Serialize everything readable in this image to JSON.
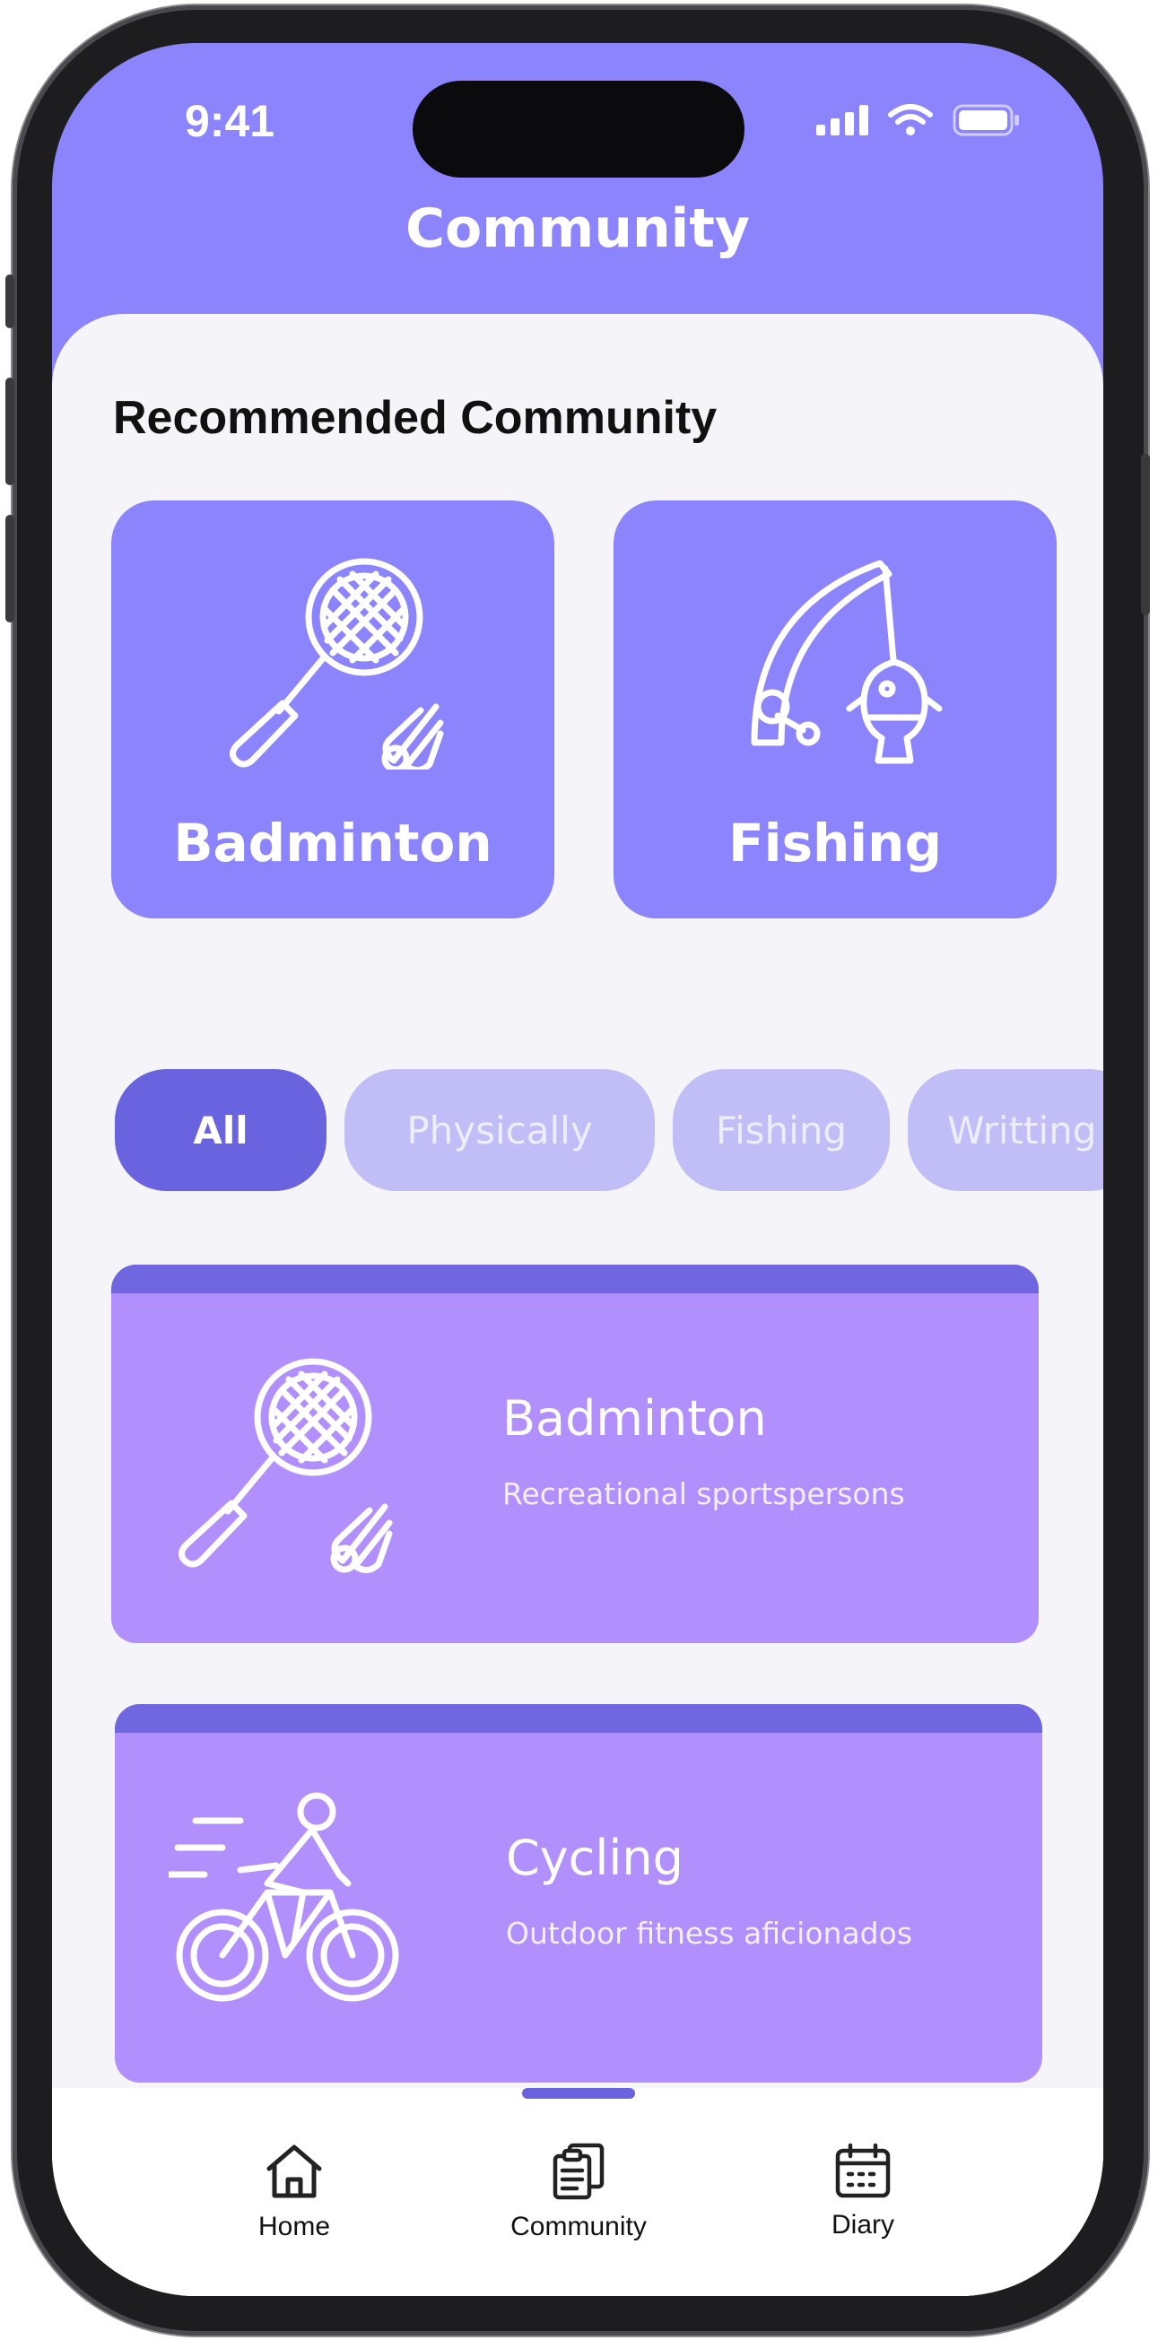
{
  "status_bar": {
    "time": "9:41"
  },
  "header": {
    "title": "Community"
  },
  "recommended": {
    "title": "Recommended Community",
    "cards": [
      {
        "label": "Badminton",
        "icon": "badminton-icon"
      },
      {
        "label": "Fishing",
        "icon": "fishing-icon"
      }
    ]
  },
  "filters": {
    "chips": [
      {
        "label": "All",
        "active": true
      },
      {
        "label": "Physically",
        "active": false
      },
      {
        "label": "Fishing",
        "active": false
      },
      {
        "label": "Writting",
        "active": false
      }
    ]
  },
  "communities": [
    {
      "name": "Badminton",
      "description": "Recreational sportspersons",
      "icon": "badminton-icon"
    },
    {
      "name": "Cycling",
      "description": "Outdoor fitness aficionados",
      "icon": "cyclist-icon"
    }
  ],
  "tab_bar": {
    "items": [
      {
        "label": "Home",
        "icon": "home-icon"
      },
      {
        "label": "Community",
        "icon": "clipboard-icon"
      },
      {
        "label": "Diary",
        "icon": "calendar-icon"
      }
    ]
  },
  "colors": {
    "primary": "#8b84fc",
    "chip_active": "#6a63df",
    "chip_inactive": "#c1bdf6",
    "card_purple": "#b18ffc",
    "background": "#f4f4f9"
  }
}
